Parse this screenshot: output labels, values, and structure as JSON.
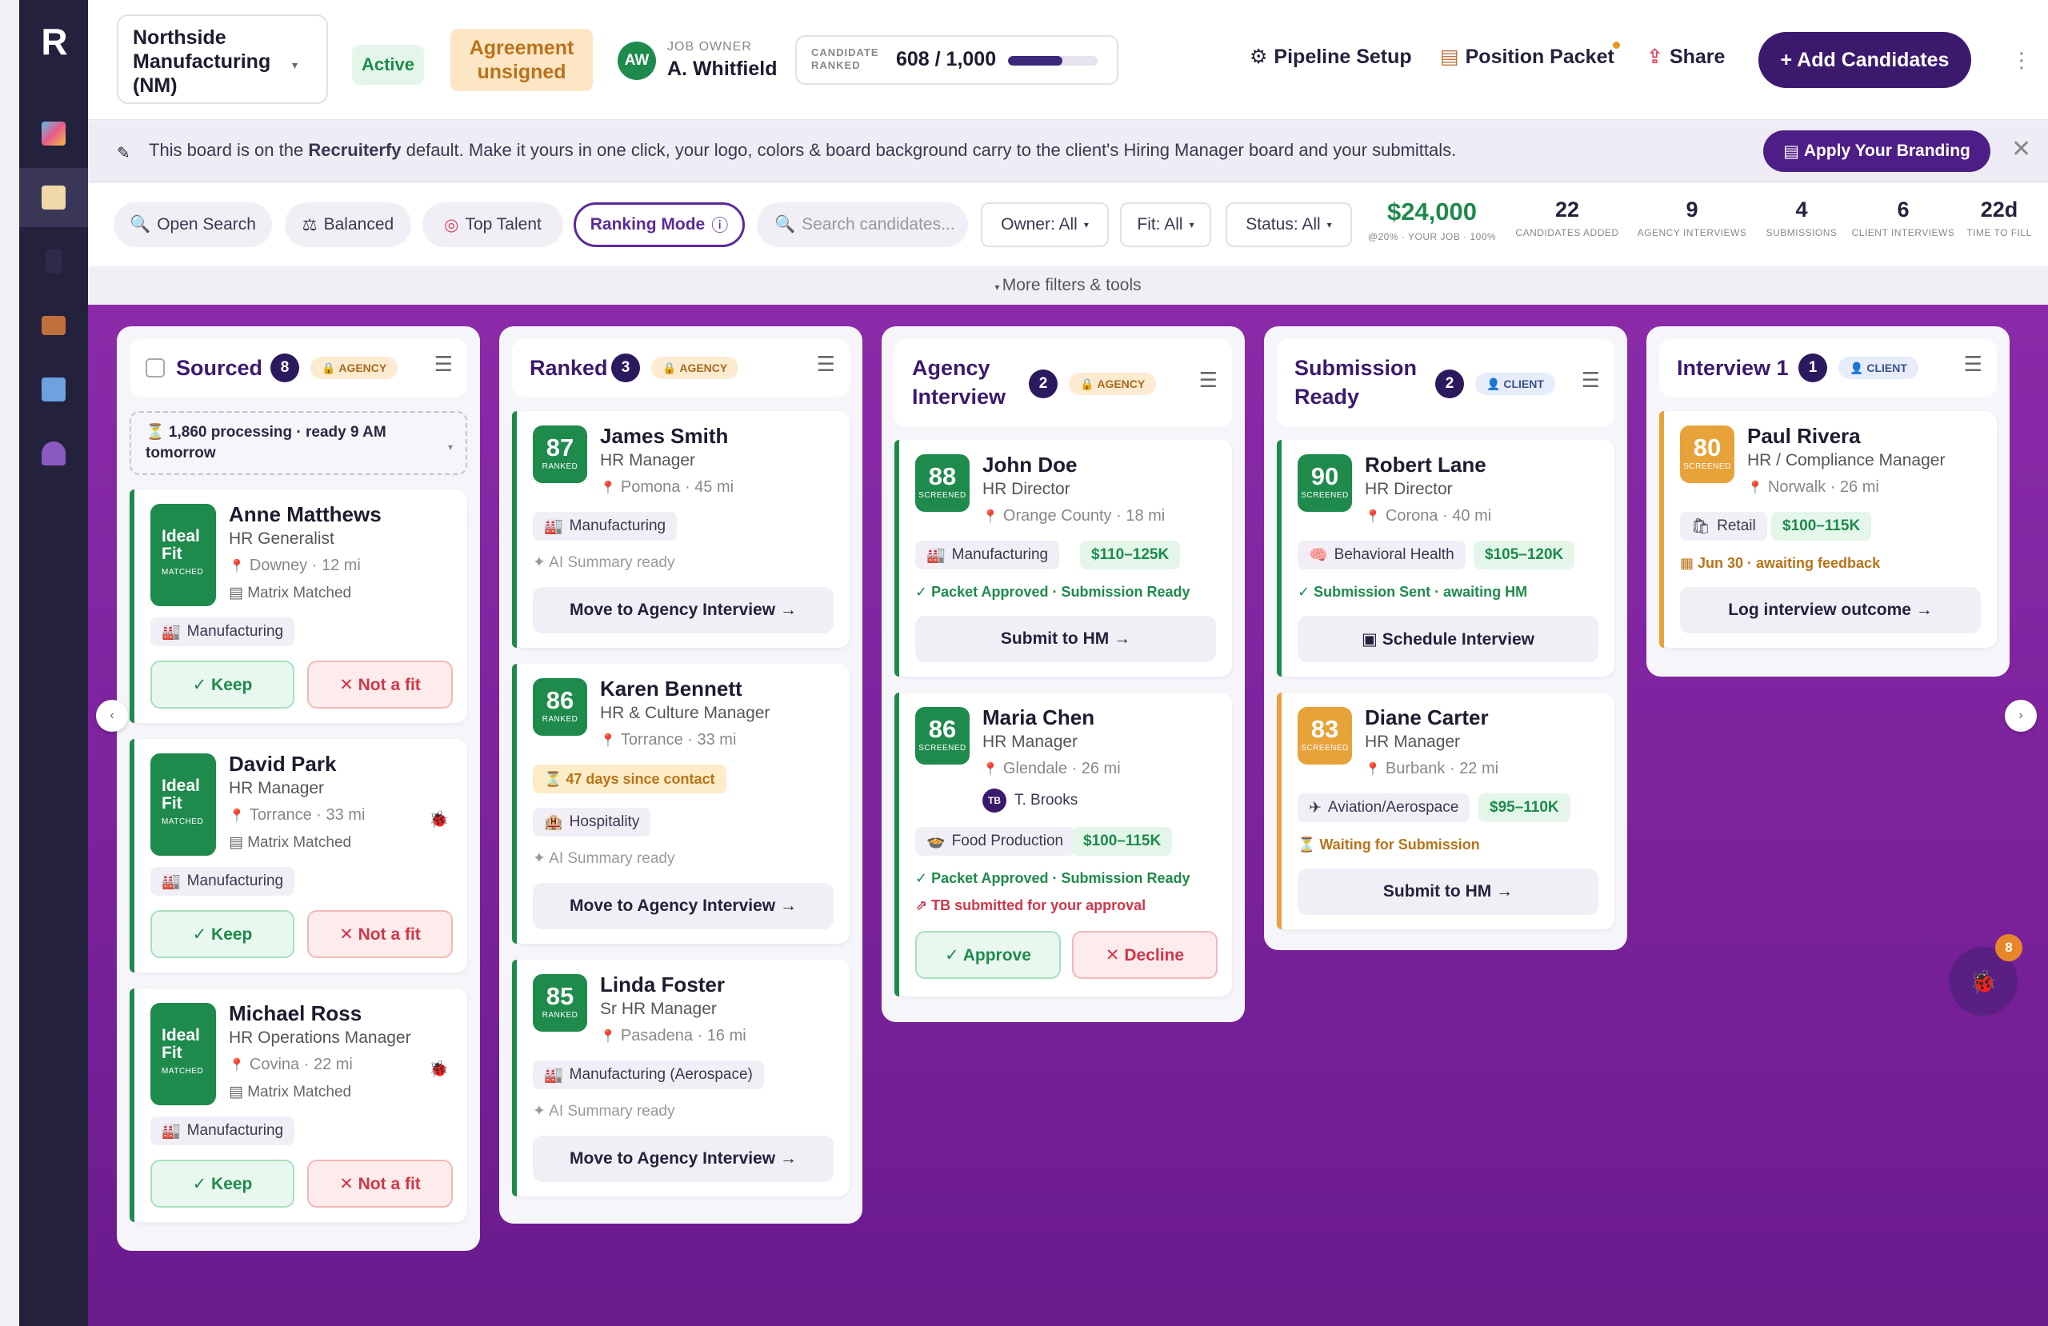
{
  "sidebar": {
    "logo": "R",
    "items": [
      {
        "name": "analytics",
        "color": "#6fb8e8"
      },
      {
        "name": "jobs",
        "color": "#f0d8a8"
      },
      {
        "name": "funnel",
        "color": "#3a3658"
      },
      {
        "name": "briefcase",
        "color": "#c0703a"
      },
      {
        "name": "reports",
        "color": "#6fa0e0"
      },
      {
        "name": "people",
        "color": "#8a5ac0"
      }
    ]
  },
  "header": {
    "company": "Northside Manufacturing (NM)",
    "status": "Active",
    "agreement": "Agreement unsigned",
    "owner_initials": "AW",
    "owner_label": "JOB OWNER",
    "owner_name": "A. Whitfield",
    "ranked_label": "CANDIDATE RANKED",
    "ranked_value": "608 / 1,000",
    "ranked_fraction": 0.608,
    "pipeline_setup": "Pipeline Setup",
    "position_packet": "Position Packet",
    "share": "Share",
    "add_candidates": "+ Add Candidates"
  },
  "banner": {
    "text_pre": "This board is on the ",
    "text_brand": "Recruiterfy",
    "text_post": " default. Make it yours in one click, your logo, colors & board background carry to the client's Hiring Manager board and your submittals.",
    "button": "Apply Your Branding"
  },
  "toolbar": {
    "open_search": "Open Search",
    "balanced": "Balanced",
    "top_talent": "Top Talent",
    "ranking_mode": "Ranking Mode",
    "search_placeholder": "Search candidates...",
    "owner_filter": "Owner: All",
    "fit_filter": "Fit: All",
    "status_filter": "Status: All",
    "more_filters": "More filters & tools"
  },
  "stats": [
    {
      "value": "$24,000",
      "label": "@20% · YOUR JOB · 100%"
    },
    {
      "value": "22",
      "label": "CANDIDATES ADDED"
    },
    {
      "value": "9",
      "label": "AGENCY INTERVIEWS"
    },
    {
      "value": "4",
      "label": "SUBMISSIONS"
    },
    {
      "value": "6",
      "label": "CLIENT INTERVIEWS"
    },
    {
      "value": "22d",
      "label": "TIME TO FILL"
    }
  ],
  "columns": {
    "sourced": {
      "title": "Sourced",
      "count": "8",
      "badge": "AGENCY",
      "processing": "⏳ 1,860 processing · ready 9 AM tomorrow",
      "cards": [
        {
          "fit_line1": "Ideal",
          "fit_line2": "Fit",
          "fit_label": "MATCHED",
          "name": "Anne Matthews",
          "role": "HR Generalist",
          "location": "Downey · 12 mi",
          "matrix": "▤ Matrix Matched",
          "industry": "Manufacturing",
          "keep": "✓ Keep",
          "notfit": "✕ Not a fit"
        },
        {
          "fit_line1": "Ideal",
          "fit_line2": "Fit",
          "fit_label": "MATCHED",
          "name": "David Park",
          "role": "HR Manager",
          "location": "Torrance · 33 mi",
          "matrix": "▤ Matrix Matched",
          "industry": "Manufacturing",
          "keep": "✓ Keep",
          "notfit": "✕ Not a fit"
        },
        {
          "fit_line1": "Ideal",
          "fit_line2": "Fit",
          "fit_label": "MATCHED",
          "name": "Michael Ross",
          "role": "HR Operations Manager",
          "location": "Covina · 22 mi",
          "matrix": "▤ Matrix Matched",
          "industry": "Manufacturing",
          "keep": "✓ Keep",
          "notfit": "✕ Not a fit"
        }
      ]
    },
    "ranked": {
      "title": "Ranked",
      "count": "3",
      "badge": "AGENCY",
      "cards": [
        {
          "score": "87",
          "score_label": "RANKED",
          "name": "James Smith",
          "role": "HR Manager",
          "location": "Pomona · 45 mi",
          "industry": "Manufacturing",
          "ai": "✦ AI Summary ready",
          "action": "Move to Agency Interview →"
        },
        {
          "score": "86",
          "score_label": "RANKED",
          "name": "Karen Bennett",
          "role": "HR & Culture Manager",
          "location": "Torrance · 33 mi",
          "contact": "⏳ 47 days since contact",
          "industry": "Hospitality",
          "ai": "✦ AI Summary ready",
          "action": "Move to Agency Interview →"
        },
        {
          "score": "85",
          "score_label": "RANKED",
          "name": "Linda Foster",
          "role": "Sr HR Manager",
          "location": "Pasadena · 16 mi",
          "industry": "Manufacturing (Aerospace)",
          "ai": "✦ AI Summary ready",
          "action": "Move to Agency Interview →"
        }
      ]
    },
    "agency": {
      "title_line1": "Agency",
      "title_line2": "Interview",
      "count": "2",
      "badge": "AGENCY",
      "cards": [
        {
          "score": "88",
          "score_label": "SCREENED",
          "name": "John Doe",
          "role": "HR Director",
          "location": "Orange County · 18 mi",
          "industry": "Manufacturing",
          "salary": "$110–125K",
          "status": "✓ Packet Approved · Submission Ready",
          "action": "Submit to HM →"
        },
        {
          "score": "86",
          "score_label": "SCREENED",
          "name": "Maria Chen",
          "role": "HR Manager",
          "location": "Glendale · 26 mi",
          "tb_initials": "TB",
          "tb_name": "T. Brooks",
          "industry": "Food Production",
          "salary": "$100–115K",
          "status": "✓ Packet Approved · Submission Ready",
          "alert": "⇗ TB submitted for your approval",
          "approve": "✓ Approve",
          "decline": "✕ Decline"
        }
      ]
    },
    "submission": {
      "title_line1": "Submission",
      "title_line2": "Ready",
      "count": "2",
      "badge": "CLIENT",
      "cards": [
        {
          "score": "90",
          "score_label": "SCREENED",
          "name": "Robert Lane",
          "role": "HR Director",
          "location": "Corona · 40 mi",
          "industry": "Behavioral Health",
          "salary": "$105–120K",
          "status": "✓ Submission Sent · awaiting HM",
          "action": "▣ Schedule Interview"
        },
        {
          "score": "83",
          "score_label": "SCREENED",
          "name": "Diane Carter",
          "role": "HR Manager",
          "location": "Burbank · 22 mi",
          "industry": "Aviation/Aerospace",
          "salary": "$95–110K",
          "status": "⏳ Waiting for Submission",
          "action": "Submit to HM →"
        }
      ]
    },
    "interview": {
      "title": "Interview 1",
      "count": "1",
      "badge": "CLIENT",
      "cards": [
        {
          "score": "80",
          "score_label": "SCREENED",
          "name": "Paul Rivera",
          "role": "HR / Compliance Manager",
          "location": "Norwalk · 26 mi",
          "industry": "Retail",
          "salary": "$100–115K",
          "status": "▦ Jun 30 · awaiting feedback",
          "action": "Log interview outcome →"
        }
      ]
    }
  },
  "fab_count": "8",
  "colors": {
    "brand": "#3b1a6e",
    "green": "#1e8a4c",
    "orange": "#e8a23a",
    "board": "#7a229c"
  }
}
